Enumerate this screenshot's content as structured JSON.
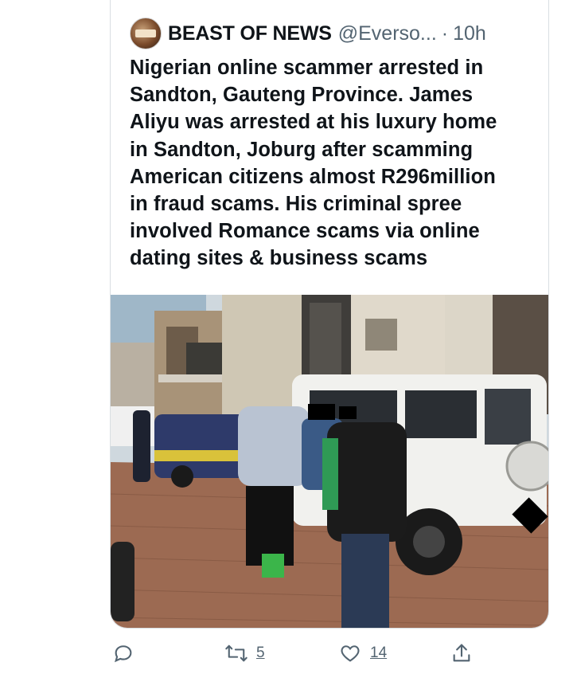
{
  "tweet": {
    "author_name": "BEAST OF NEWS",
    "author_handle": "@Everso...",
    "separator": "·",
    "timestamp": "10h",
    "text_lines": [
      "Nigerian online scammer arrested in",
      "Sandton, Gauteng Province. James",
      "Aliyu was arrested at his luxury home",
      "in Sandton, Joburg after scamming",
      "American citizens almost R296million",
      "in fraud scams. His criminal spree",
      "involved Romance scams via online",
      "dating sites & business scams"
    ],
    "icons": {
      "reply": "reply-icon",
      "retweet": "retweet-icon",
      "like": "heart-icon",
      "share": "share-icon",
      "avatar": "avatar"
    }
  },
  "actions": {
    "retweet_count": "5",
    "like_count": "14"
  },
  "colors": {
    "text": "#0f1419",
    "muted": "#536471",
    "border": "#d9dee2"
  }
}
